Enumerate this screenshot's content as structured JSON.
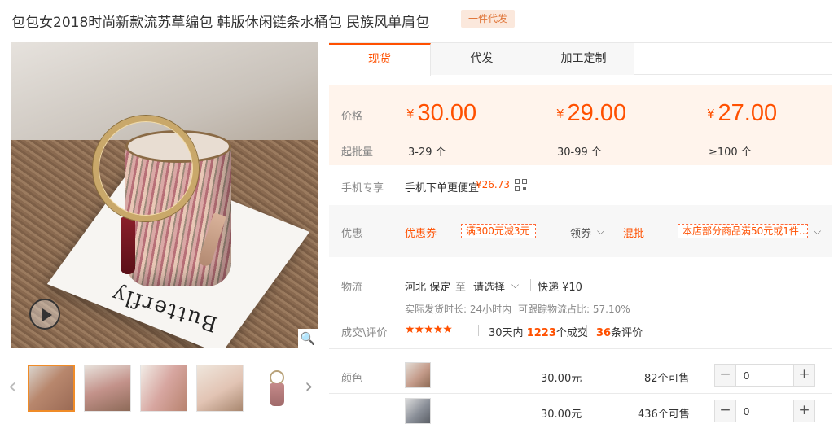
{
  "title": "包包女2018时尚新款流苏草编包 韩版休闲链条水桶包 民族风单肩包",
  "title_badge": "一件代发",
  "gallery": {
    "main_card_text": "Butterfly",
    "zoom_glyph": "🔍",
    "prev_arrow": "‹",
    "next_arrow": "›",
    "active_thumb": 0
  },
  "tabs": [
    {
      "label": "现货",
      "active": true
    },
    {
      "label": "代发",
      "active": false
    },
    {
      "label": "加工定制",
      "active": false
    }
  ],
  "price_box": {
    "price_label": "价格",
    "moq_label": "起批量",
    "currency": "¥",
    "tiers": [
      {
        "price": "30.00",
        "range": "3-29 个"
      },
      {
        "price": "29.00",
        "range": "30-99 个"
      },
      {
        "price": "27.00",
        "range": "≥100 个"
      }
    ]
  },
  "mobile": {
    "label": "手机专享",
    "text": "手机下单更便宜",
    "price": "¥26.73"
  },
  "discount": {
    "label": "优惠",
    "coupon_label": "优惠券",
    "coupon_tag": "满300元减3元",
    "claim_label": "领券",
    "mix_label": "混批",
    "mix_tag": "本店部分商品满50元或1件..."
  },
  "logistics": {
    "label": "物流",
    "from": "河北 保定",
    "to_word": "至",
    "to_select": "请选择",
    "express": "快递 ¥10",
    "ship_time": "实际发货时长: 24小时内",
    "track_rate": "可跟踪物流占比: 57.10%"
  },
  "reviews": {
    "label": "成交\\评价",
    "stars": "★★★★★",
    "rating": 4.5,
    "days_prefix": "30天内",
    "deals": "1223",
    "deals_suffix": "个成交",
    "review_count": "36",
    "review_suffix": "条评价"
  },
  "sku": {
    "label": "颜色",
    "rows": [
      {
        "price": "30.00元",
        "stock": "82个可售",
        "qty": "0"
      },
      {
        "price": "30.00元",
        "stock": "436个可售",
        "qty": "0"
      }
    ],
    "minus": "−",
    "plus": "+"
  },
  "colors": {
    "accent": "#ff5000",
    "price_bg": "#fff4ec",
    "badge_bg": "#fbe8dc"
  }
}
